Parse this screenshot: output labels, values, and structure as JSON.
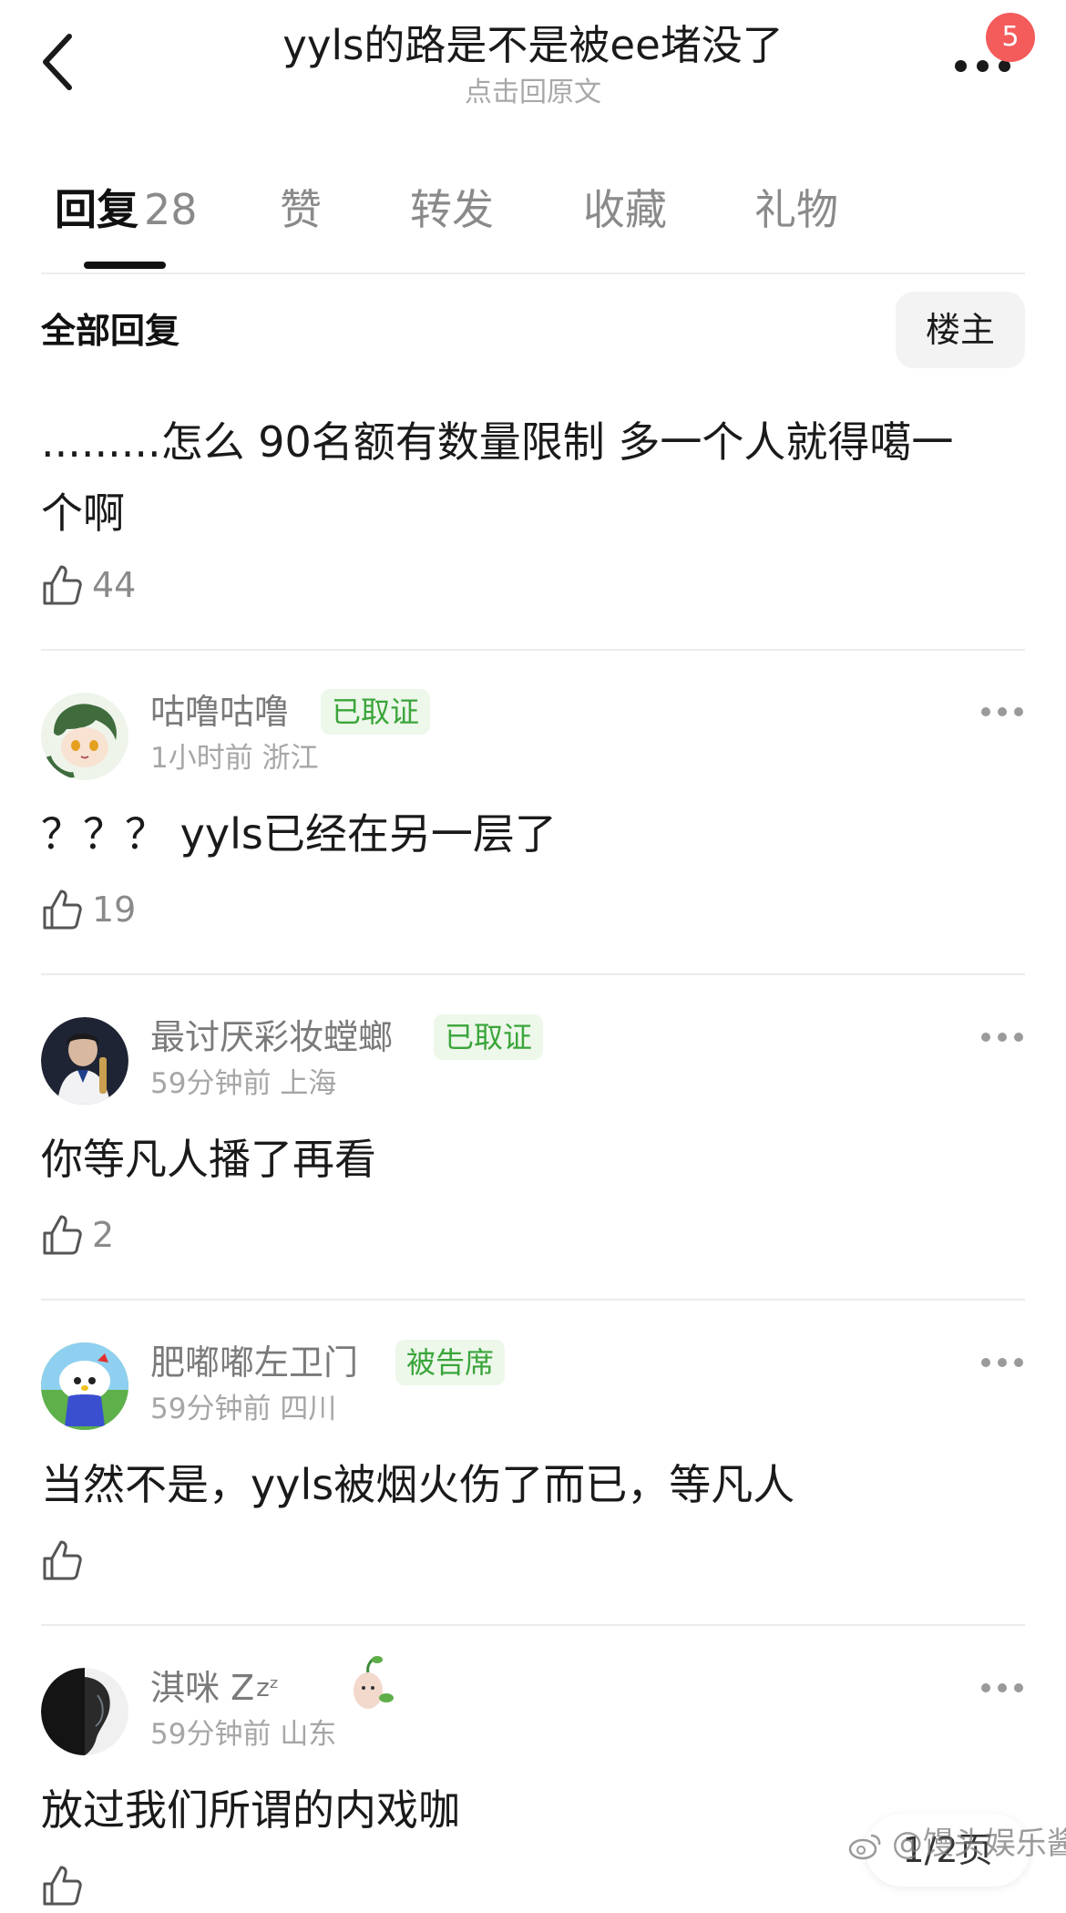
{
  "header": {
    "title": "yyls的路是不是被ee堵没了",
    "subtitle": "点击回原文",
    "notification_count": "5"
  },
  "tabs": [
    {
      "label": "回复",
      "count": "28",
      "active": true
    },
    {
      "label": "赞",
      "count": "",
      "active": false
    },
    {
      "label": "转发",
      "count": "",
      "active": false
    },
    {
      "label": "收藏",
      "count": "",
      "active": false
    },
    {
      "label": "礼物",
      "count": "",
      "active": false
    }
  ],
  "filter": {
    "label": "全部回复",
    "op_button": "楼主"
  },
  "original_post": {
    "line1": ".........怎么 90名额有数量限制 多一个人就得噶一",
    "line2": "个啊",
    "likes": "44"
  },
  "comments": [
    {
      "user": "咕噜咕噜",
      "tag": "已取证",
      "time": "1小时前",
      "location": "浙江",
      "text": "？？？ yyls已经在另一层了",
      "likes": "19",
      "avatar_icon": "anime-avatar-icon"
    },
    {
      "user": "最讨厌彩妆螳螂",
      "tag": "已取证",
      "time": "59分钟前",
      "location": "上海",
      "text": "你等凡人播了再看",
      "likes": "2",
      "avatar_icon": "athlete-avatar-icon"
    },
    {
      "user": "肥嘟嘟左卫门",
      "tag": "被告席",
      "time": "59分钟前",
      "location": "四川",
      "text": "当然不是，yyls被烟火伤了而已，等凡人",
      "likes": "",
      "avatar_icon": "cartoon-cat-avatar-icon"
    },
    {
      "user": "淇咪 Z",
      "user_suffix": "zᶻ",
      "tag": "",
      "time": "59分钟前",
      "location": "山东",
      "text": "放过我们所谓的内戏咖",
      "likes": "",
      "avatar_icon": "silhouette-avatar-icon"
    }
  ],
  "footer": {
    "page_indicator": "1/2页",
    "watermark": "@馒头娱乐酱"
  },
  "colors": {
    "badge": "#f45b5b",
    "tag_bg": "#edf7ea",
    "tag_text": "#3aa53a",
    "muted": "#8a8a8a"
  }
}
